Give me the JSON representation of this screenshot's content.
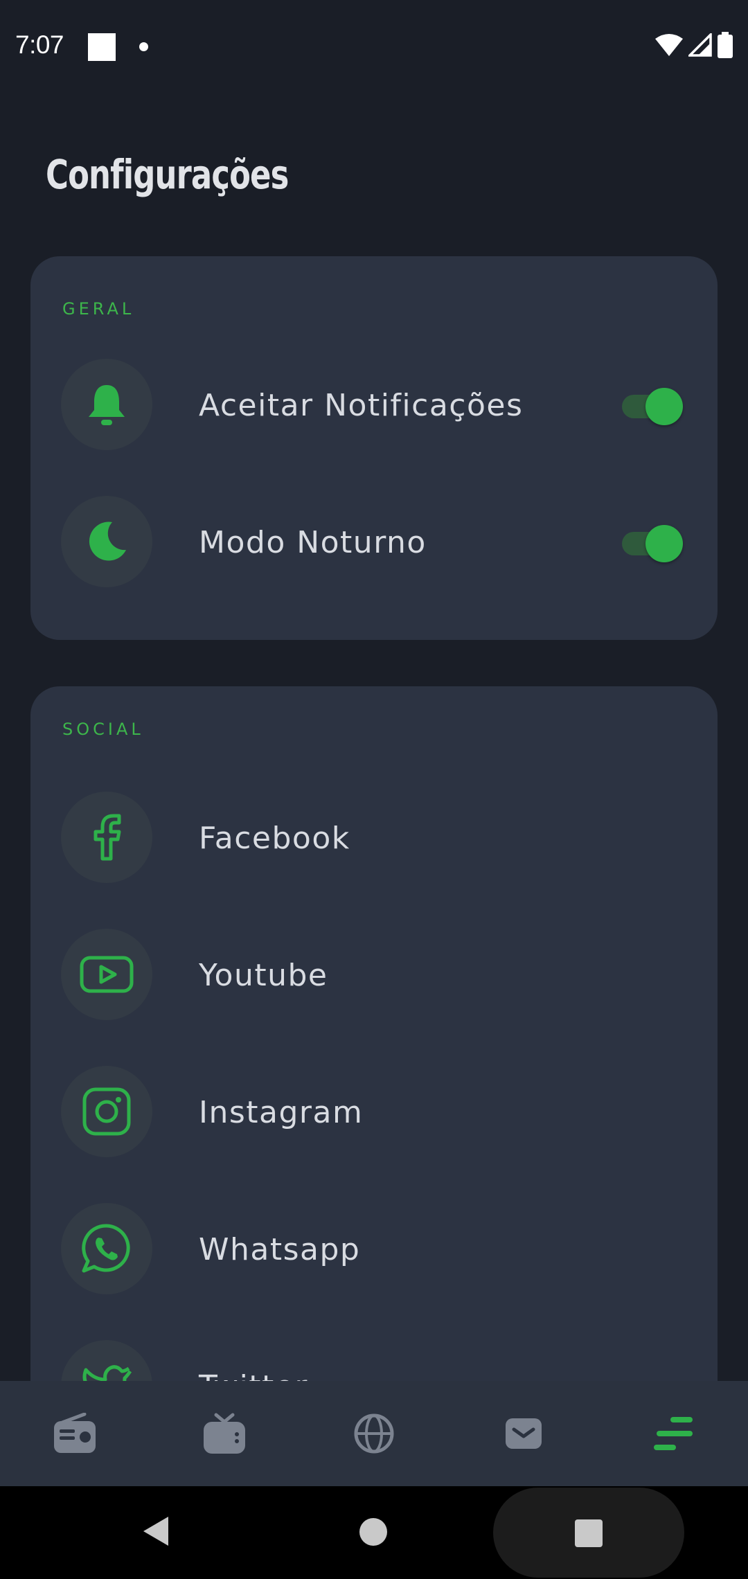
{
  "status_bar": {
    "time": "7:07"
  },
  "page": {
    "title": "Configurações"
  },
  "general": {
    "header": "GERAL",
    "items": [
      {
        "label": "Aceitar Notificações",
        "icon": "bell-icon",
        "toggle_on": true
      },
      {
        "label": "Modo Noturno",
        "icon": "moon-icon",
        "toggle_on": true
      }
    ]
  },
  "social": {
    "header": "SOCIAL",
    "items": [
      {
        "label": "Facebook",
        "icon": "facebook-icon"
      },
      {
        "label": "Youtube",
        "icon": "youtube-icon"
      },
      {
        "label": "Instagram",
        "icon": "instagram-icon"
      },
      {
        "label": "Whatsapp",
        "icon": "whatsapp-icon"
      },
      {
        "label": "Twitter",
        "icon": "twitter-icon"
      }
    ]
  },
  "bottom_nav": {
    "items": [
      {
        "icon": "radio-icon",
        "active": false
      },
      {
        "icon": "tv-icon",
        "active": false
      },
      {
        "icon": "globe-icon",
        "active": false
      },
      {
        "icon": "mail-icon",
        "active": false
      },
      {
        "icon": "settings-menu-icon",
        "active": true
      }
    ]
  },
  "colors": {
    "background": "#1a1e27",
    "card": "#2c3342",
    "accent": "#3db64b",
    "nav_bar": "#2b323f",
    "nav_inactive": "#7c8390"
  }
}
